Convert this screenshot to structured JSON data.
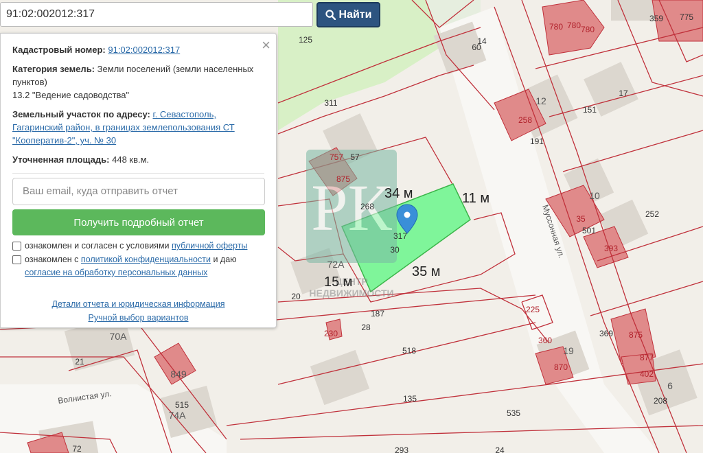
{
  "search": {
    "query": "91:02:002012:317",
    "button_label": "Найти"
  },
  "panel": {
    "cadastral_label": "Кадастровый номер:",
    "cadastral_value": "91:02:002012:317",
    "category_label": "Категория земель:",
    "category_value": "Земли поселений (земли населенных пунктов)",
    "category_sub": "13.2 \"Ведение садоводства\"",
    "address_label": "Земельный участок по адресу:",
    "address_value": "г. Севастополь, Гагаринский район, в границах землепользования СТ \"Кооператив-2\", уч. № 30",
    "area_label": "Уточненная площадь:",
    "area_value": "448 кв.м.",
    "email_placeholder": "Ваш email, куда отправить отчет",
    "report_button": "Получить подробный отчет",
    "consent1_text": "ознакомлен и согласен с условиями",
    "consent1_link": "публичной оферты",
    "consent2_text_a": "ознакомлен с",
    "consent2_link_a": "политикой конфиденциальности",
    "consent2_text_b": "и даю",
    "consent2_link_b": "согласие на обработку персональных данных",
    "details_link": "Детали отчета и юридическая информация",
    "manual_link": "Ручной выбор вариантов",
    "close_symbol": "×"
  },
  "map": {
    "dimensions": [
      "34 м",
      "11 м",
      "35 м",
      "15 м"
    ],
    "streets": [
      "Муссонная ул.",
      "Волнистая ул."
    ],
    "watermark_letters": "РК",
    "watermark_text": [
      "ЦЕНТР",
      "НЕДВИЖИМОСТИ"
    ],
    "labels": [
      "125",
      "311",
      "757",
      "57",
      "875",
      "268",
      "317",
      "30",
      "72А",
      "20",
      "187",
      "28",
      "230",
      "60",
      "14",
      "17",
      "12",
      "151",
      "258",
      "191",
      "10",
      "35",
      "501",
      "252",
      "393",
      "225",
      "360",
      "870",
      "19",
      "369",
      "875",
      "877",
      "402",
      "6",
      "208",
      "518",
      "135",
      "535",
      "70А",
      "21",
      "849",
      "515",
      "74А",
      "72",
      "293",
      "24",
      "780",
      "780",
      "780",
      "359",
      "775"
    ],
    "colors": {
      "selected_parcel": "#7ff59a",
      "building": "#e08a8a",
      "boundary": "#c0313b",
      "green_area": "#d8f0c6",
      "marker": "#3a8fd8"
    }
  }
}
